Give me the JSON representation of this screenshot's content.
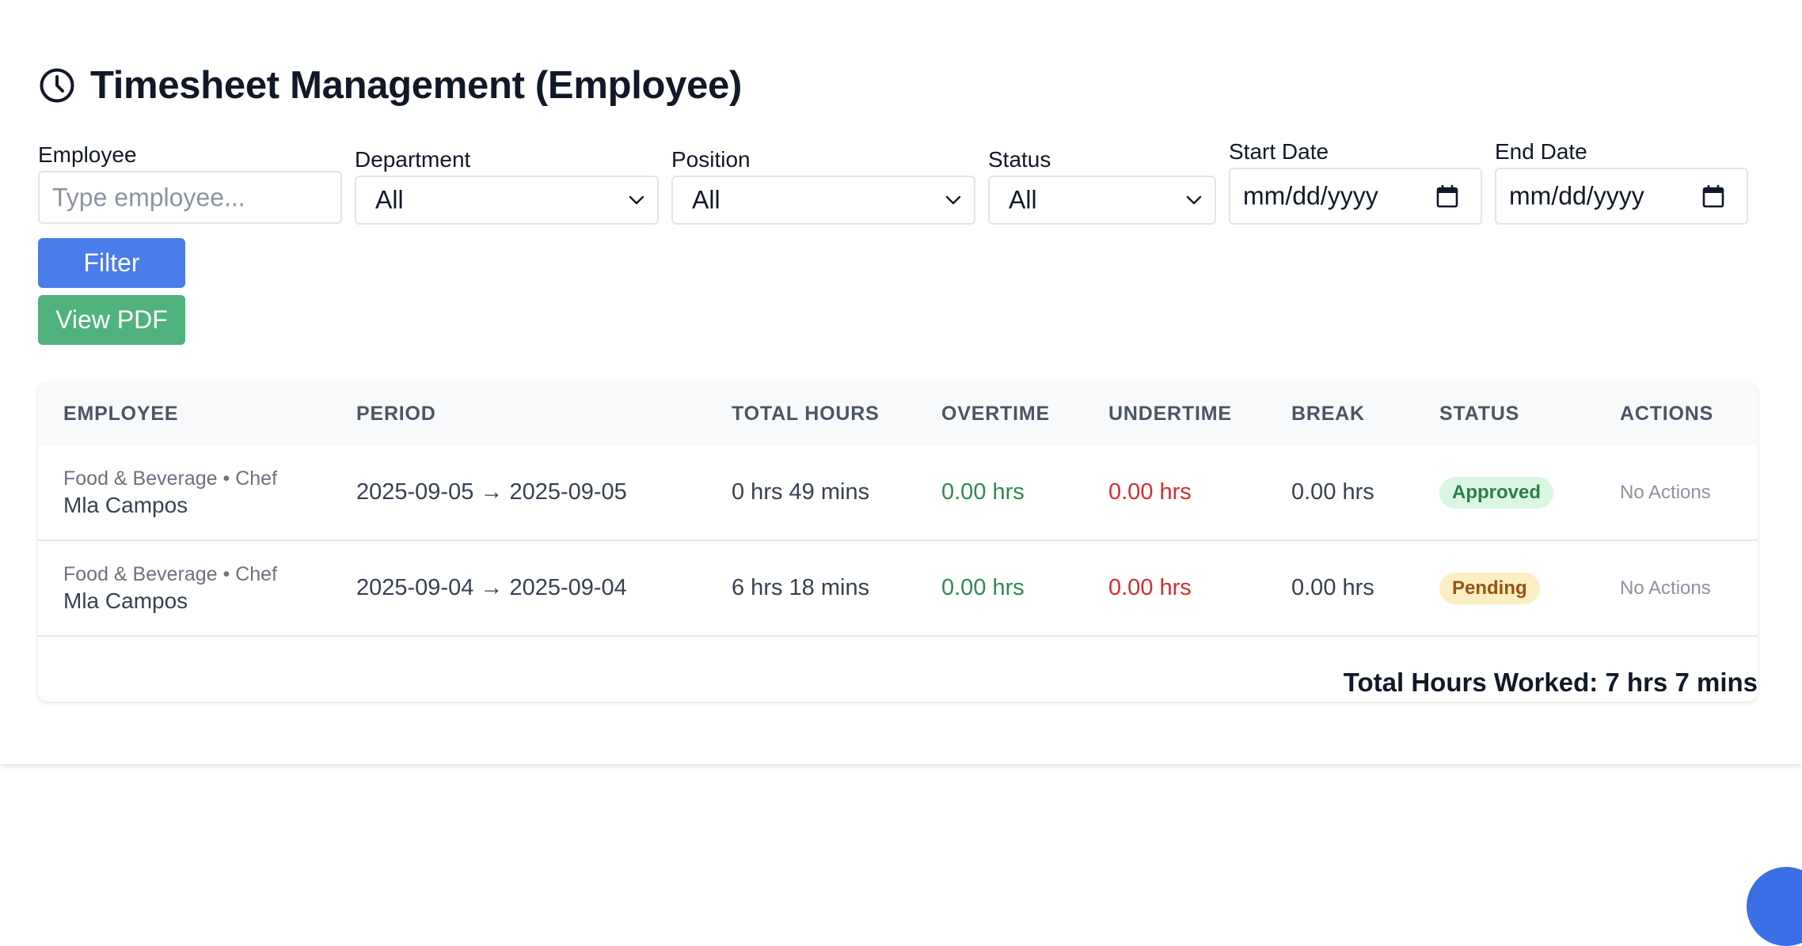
{
  "page": {
    "title": "Timesheet Management (Employee)",
    "title_icon": "clock-icon"
  },
  "filters": {
    "employee": {
      "label": "Employee",
      "placeholder": "Type employee..."
    },
    "department": {
      "label": "Department",
      "value": "All"
    },
    "position": {
      "label": "Position",
      "value": "All"
    },
    "status": {
      "label": "Status",
      "value": "All"
    },
    "start_date": {
      "label": "Start Date",
      "placeholder": "mm/dd/yyyy"
    },
    "end_date": {
      "label": "End Date",
      "placeholder": "mm/dd/yyyy"
    }
  },
  "buttons": {
    "filter": {
      "label": "Filter",
      "color": "#4a7de9"
    },
    "view_pdf": {
      "label": "View PDF",
      "color": "#50b37d"
    }
  },
  "table": {
    "columns": [
      "EMPLOYEE",
      "PERIOD",
      "TOTAL HOURS",
      "OVERTIME",
      "UNDERTIME",
      "BREAK",
      "STATUS",
      "ACTIONS"
    ],
    "rows": [
      {
        "meta": "Food & Beverage • Chef",
        "name": "Mla Campos",
        "period": "2025-09-05 → 2025-09-05",
        "total_hours": "0 hrs 49 mins",
        "overtime": "0.00 hrs",
        "undertime": "0.00 hrs",
        "break": "0.00 hrs",
        "status": "Approved",
        "actions": "No Actions"
      },
      {
        "meta": "Food & Beverage • Chef",
        "name": "Mla Campos",
        "period": "2025-09-04 → 2025-09-04",
        "total_hours": "6 hrs 18 mins",
        "overtime": "0.00 hrs",
        "undertime": "0.00 hrs",
        "break": "0.00 hrs",
        "status": "Pending",
        "actions": "No Actions"
      }
    ],
    "total": "Total Hours Worked: 7 hrs 7 mins"
  },
  "colors": {
    "overtime": "#2f8a4f",
    "undertime": "#d32f2f",
    "approved_badge": "#d9f7e3",
    "pending_badge": "#fdefc4",
    "fab": "#3b6fe8"
  }
}
